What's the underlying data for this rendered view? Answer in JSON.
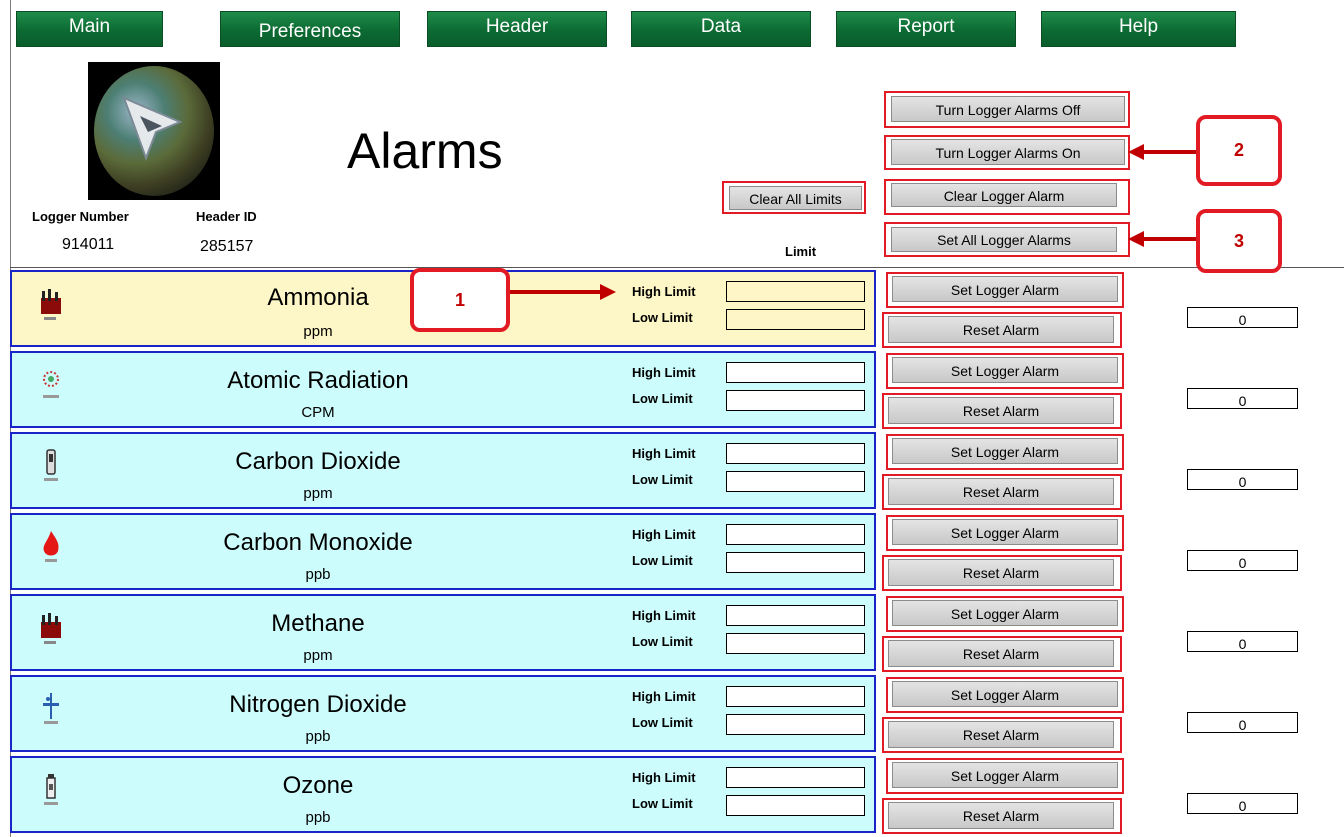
{
  "nav": {
    "tabs": [
      "Main",
      "Preferences",
      "Header",
      "Data",
      "Report",
      "Help"
    ]
  },
  "page_title": "Alarms",
  "logger": {
    "number_label": "Logger Number",
    "number": "914011",
    "header_label": "Header ID",
    "header_id": "285157"
  },
  "limit_label": "Limit",
  "buttons": {
    "clear_all_limits": "Clear All Limits",
    "alarms_off": "Turn Logger Alarms Off",
    "alarms_on": "Turn Logger Alarms On",
    "clear_alarm": "Clear Logger Alarm",
    "set_all": "Set All Logger Alarms"
  },
  "row_labels": {
    "high": "High Limit",
    "low": "Low Limit",
    "set": "Set Logger Alarm",
    "reset": "Reset Alarm"
  },
  "gases": [
    {
      "name": "Ammonia",
      "unit": "ppm",
      "count": "0",
      "icon": "factory-icon"
    },
    {
      "name": "Atomic Radiation",
      "unit": "CPM",
      "count": "0",
      "icon": "radiation-icon"
    },
    {
      "name": "Carbon Dioxide",
      "unit": "ppm",
      "count": "0",
      "icon": "co2-icon"
    },
    {
      "name": "Carbon Monoxide",
      "unit": "ppb",
      "count": "0",
      "icon": "fire-icon"
    },
    {
      "name": "Methane",
      "unit": "ppm",
      "count": "0",
      "icon": "factory-icon"
    },
    {
      "name": "Nitrogen Dioxide",
      "unit": "ppb",
      "count": "0",
      "icon": "no2-icon"
    },
    {
      "name": "Ozone",
      "unit": "ppb",
      "count": "0",
      "icon": "ozone-icon"
    }
  ],
  "callouts": [
    "1",
    "2",
    "3"
  ],
  "colors": {
    "nav_green": "#0c6a32",
    "row_yellow": "#fdf6c6",
    "row_cyan": "#ccfcfc",
    "row_border": "#1a25c8",
    "highlight_red": "#e21a23"
  }
}
